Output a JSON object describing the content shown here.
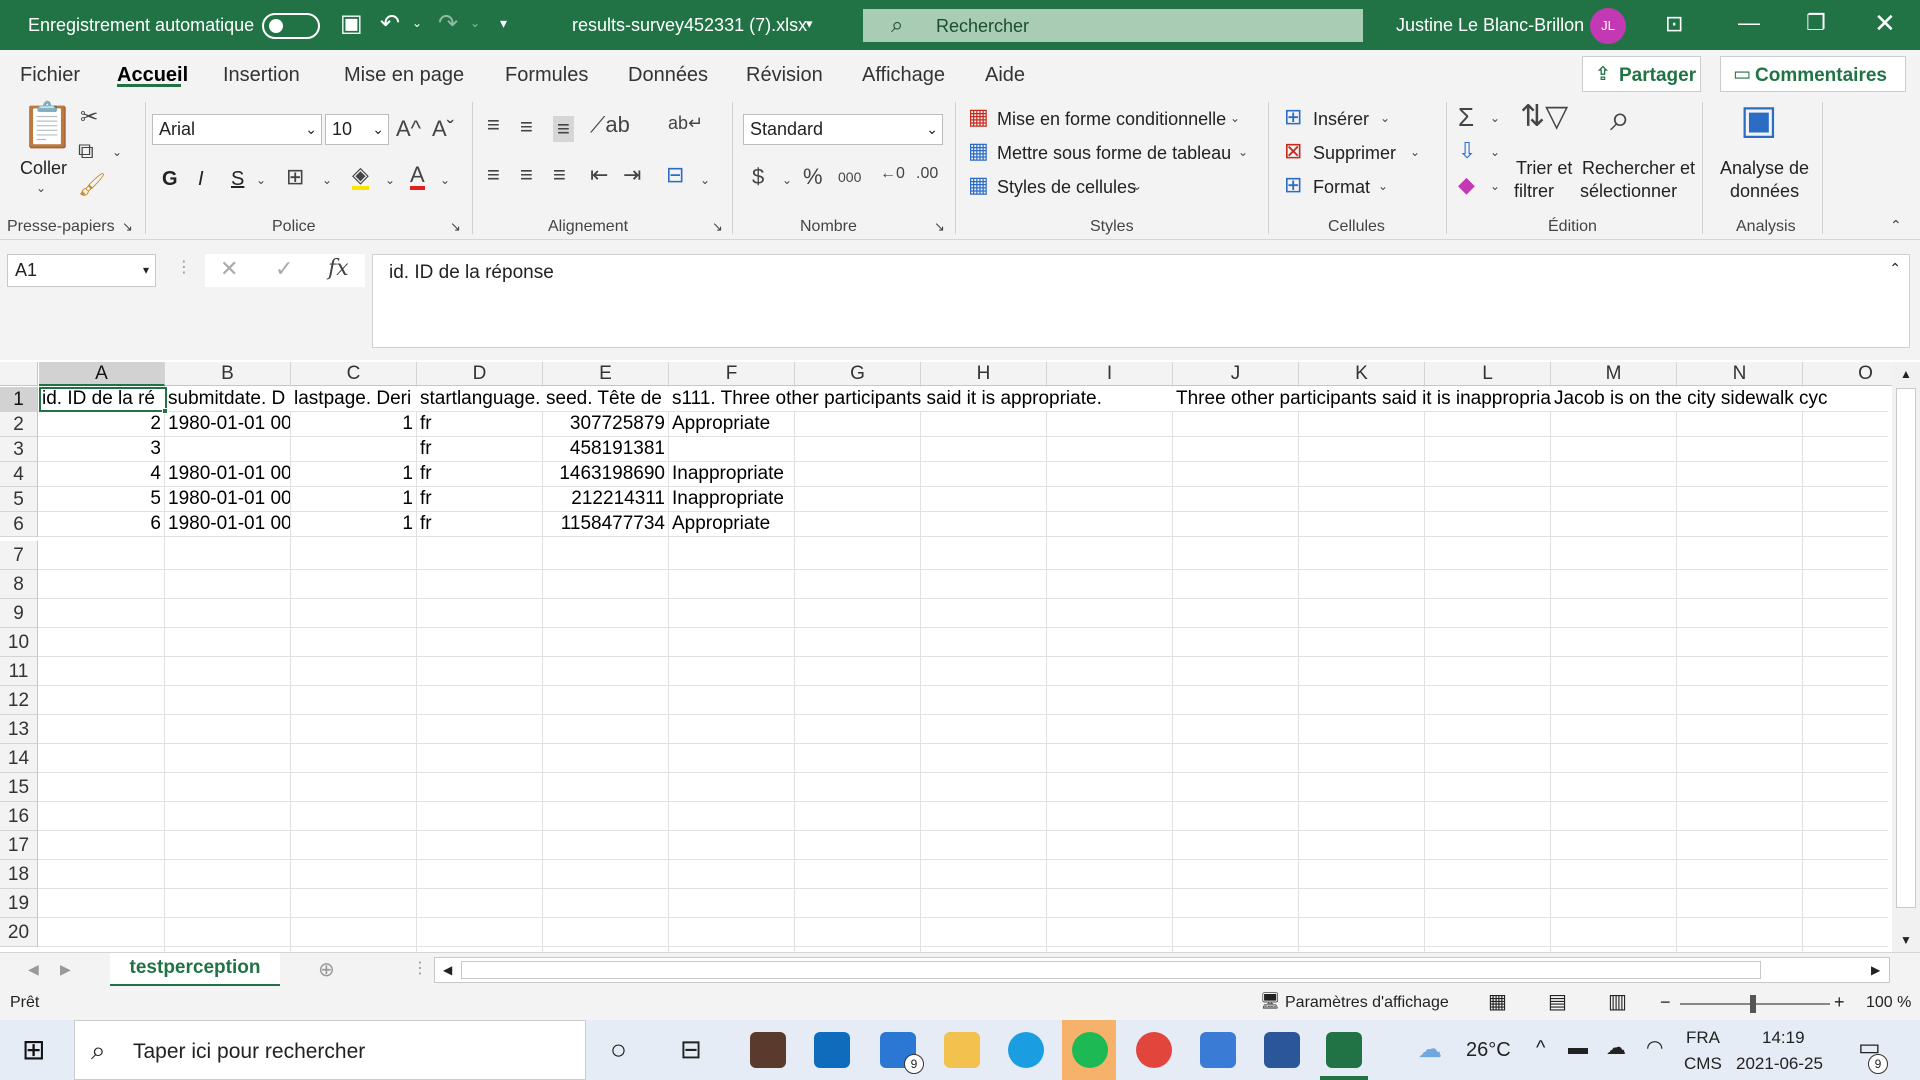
{
  "titlebar": {
    "autosave_label": "Enregistrement automatique",
    "filename": "results-survey452331 (7).xlsx",
    "search_placeholder": "Rechercher",
    "user_name": "Justine Le Blanc-Brillon",
    "user_initials": "JL"
  },
  "tabs": [
    "Fichier",
    "Accueil",
    "Insertion",
    "Mise en page",
    "Formules",
    "Données",
    "Révision",
    "Affichage",
    "Aide"
  ],
  "share_label": "Partager",
  "comments_label": "Commentaires",
  "ribbon": {
    "clipboard": {
      "paste": "Coller",
      "group": "Presse-papiers"
    },
    "font": {
      "name": "Arial",
      "size": "10",
      "bold": "G",
      "italic": "I",
      "underline": "S",
      "group": "Police"
    },
    "alignment": {
      "group": "Alignement"
    },
    "number": {
      "format": "Standard",
      "group": "Nombre"
    },
    "styles": {
      "conditional": "Mise en forme conditionnelle",
      "table": "Mettre sous forme de tableau",
      "cell_styles": "Styles de cellules",
      "group": "Styles"
    },
    "cells": {
      "insert": "Insérer",
      "delete": "Supprimer",
      "format": "Format",
      "group": "Cellules"
    },
    "editing": {
      "sort_l1": "Trier et",
      "sort_l2": "filtrer",
      "find_l1": "Rechercher et",
      "find_l2": "sélectionner",
      "group": "Édition"
    },
    "analysis": {
      "l1": "Analyse de",
      "l2": "données",
      "group": "Analysis"
    }
  },
  "formula_bar": {
    "name_box": "A1",
    "content": "id. ID de la réponse"
  },
  "columns": [
    "A",
    "B",
    "C",
    "D",
    "E",
    "F",
    "G",
    "H",
    "I",
    "J",
    "K",
    "L",
    "M",
    "N",
    "O"
  ],
  "rows": [
    "1",
    "2",
    "3",
    "4",
    "5",
    "6",
    "7",
    "8",
    "9",
    "10",
    "11",
    "12",
    "13",
    "14",
    "15",
    "16",
    "17",
    "18",
    "19",
    "20"
  ],
  "cells": {
    "r1": {
      "A": "id. ID de la ré",
      "B": "submitdate. D",
      "C": "lastpage. Deri",
      "D": "startlanguage.",
      "E": "seed. Tête de",
      "F": "s111. Three other participants said it is appropriate.",
      "J": "Three other participants said it is inappropriate.",
      "M": "Jacob is on the city sidewalk cyc"
    },
    "r2": {
      "A": "2",
      "B": "1980-01-01 00",
      "C": "1",
      "D": "fr",
      "E": "307725879",
      "F": "Appropriate"
    },
    "r3": {
      "A": "3",
      "D": "fr",
      "E": "458191381"
    },
    "r4": {
      "A": "4",
      "B": "1980-01-01 00",
      "C": "1",
      "D": "fr",
      "E": "1463198690",
      "F": "Inappropriate"
    },
    "r5": {
      "A": "5",
      "B": "1980-01-01 00",
      "C": "1",
      "D": "fr",
      "E": "212214311",
      "F": "Inappropriate"
    },
    "r6": {
      "A": "6",
      "B": "1980-01-01 00",
      "C": "1",
      "D": "fr",
      "E": "1158477734",
      "F": "Appropriate"
    }
  },
  "sheet_tab": "testperception",
  "status": {
    "ready": "Prêt",
    "display_settings": "Paramètres d'affichage",
    "zoom": "100 %"
  },
  "taskbar": {
    "search_placeholder": "Taper ici pour rechercher",
    "temperature": "26°C",
    "lang1": "FRA",
    "lang2": "CMS",
    "time": "14:19",
    "date": "2021-06-25",
    "mail_badge": "9",
    "notif_badge": "9"
  },
  "colors": {
    "excel_green": "#217346",
    "ribbon_bg": "#f3f3f3",
    "avatar": "#c239b3"
  }
}
